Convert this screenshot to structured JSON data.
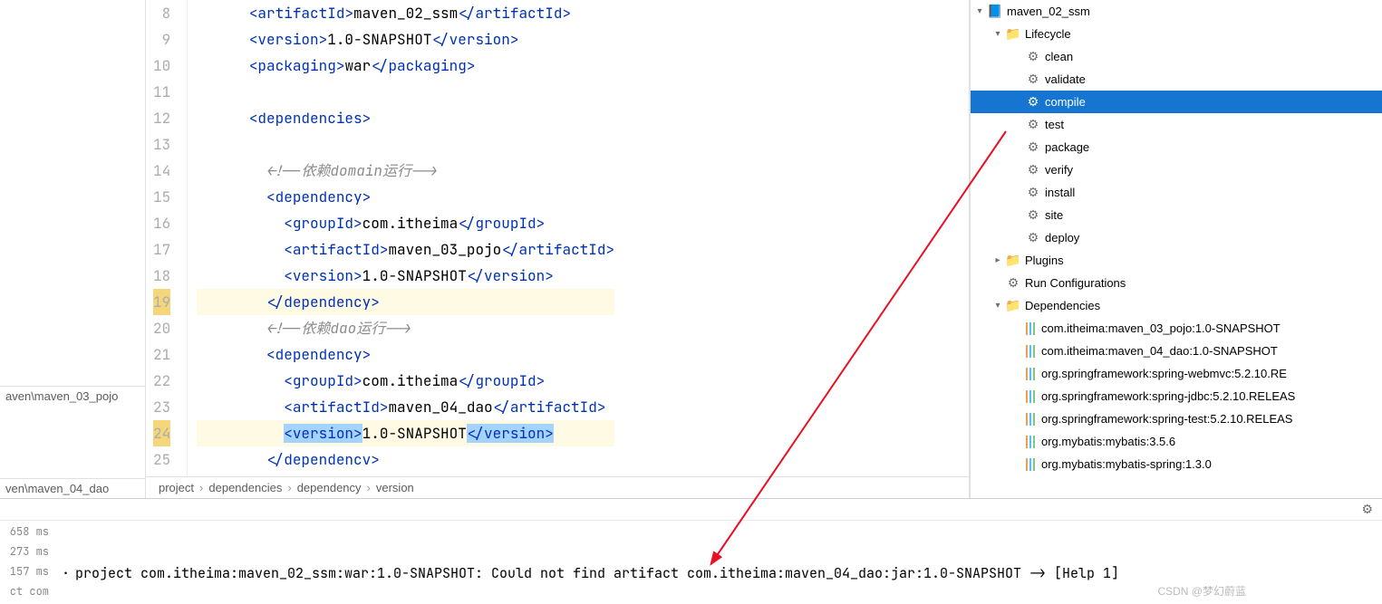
{
  "editor": {
    "lines": [
      {
        "num": 8,
        "indent": 3,
        "type": "el",
        "tag": "artifactId",
        "content": "maven_02_ssm"
      },
      {
        "num": 9,
        "indent": 3,
        "type": "el",
        "tag": "version",
        "content": "1.0-SNAPSHOT"
      },
      {
        "num": 10,
        "indent": 3,
        "type": "el",
        "tag": "packaging",
        "content": "war"
      },
      {
        "num": 11,
        "indent": 0,
        "type": "blank"
      },
      {
        "num": 12,
        "indent": 3,
        "type": "open",
        "tag": "dependencies"
      },
      {
        "num": 13,
        "indent": 0,
        "type": "blank"
      },
      {
        "num": 14,
        "indent": 4,
        "type": "comment",
        "content": "<!--依赖domain运行-->"
      },
      {
        "num": 15,
        "indent": 4,
        "type": "open",
        "tag": "dependency"
      },
      {
        "num": 16,
        "indent": 5,
        "type": "el",
        "tag": "groupId",
        "content": "com.itheima"
      },
      {
        "num": 17,
        "indent": 5,
        "type": "el",
        "tag": "artifactId",
        "content": "maven_03_pojo"
      },
      {
        "num": 18,
        "indent": 5,
        "type": "el",
        "tag": "version",
        "content": "1.0-SNAPSHOT"
      },
      {
        "num": 19,
        "indent": 4,
        "type": "close",
        "tag": "dependency",
        "hl": true
      },
      {
        "num": 20,
        "indent": 4,
        "type": "comment",
        "content": "<!--依赖dao运行-->"
      },
      {
        "num": 21,
        "indent": 4,
        "type": "open",
        "tag": "dependency"
      },
      {
        "num": 22,
        "indent": 5,
        "type": "el",
        "tag": "groupId",
        "content": "com.itheima"
      },
      {
        "num": 23,
        "indent": 5,
        "type": "el",
        "tag": "artifactId",
        "content": "maven_04_dao"
      },
      {
        "num": 24,
        "indent": 5,
        "type": "el",
        "tag": "version",
        "content": "1.0-SNAPSHOT",
        "sel": true,
        "hl": true
      },
      {
        "num": 25,
        "indent": 4,
        "type": "close",
        "tag": "dependencv"
      }
    ],
    "breadcrumb": [
      "project",
      "dependencies",
      "dependency",
      "version"
    ]
  },
  "left_tabs": [
    "aven\\maven_03_pojo",
    "ven\\maven_04_dao"
  ],
  "maven": {
    "root": "maven_02_ssm",
    "lifecycle_label": "Lifecycle",
    "lifecycle": [
      "clean",
      "validate",
      "compile",
      "test",
      "package",
      "verify",
      "install",
      "site",
      "deploy"
    ],
    "selected": "compile",
    "plugins_label": "Plugins",
    "run_config_label": "Run Configurations",
    "deps_label": "Dependencies",
    "deps": [
      "com.itheima:maven_03_pojo:1.0-SNAPSHOT",
      "com.itheima:maven_04_dao:1.0-SNAPSHOT",
      "org.springframework:spring-webmvc:5.2.10.RE",
      "org.springframework:spring-jdbc:5.2.10.RELEAS",
      "org.springframework:spring-test:5.2.10.RELEAS",
      "org.mybatis:mybatis:3.5.6",
      "org.mybatis:mybatis-spring:1.3.0"
    ]
  },
  "console": {
    "timings": [
      "658 ms",
      "273 ms",
      "157 ms",
      "ct com"
    ],
    "error": "project com.itheima:maven_02_ssm:war:1.0-SNAPSHOT: Could not find artifact com.itheima:maven_04_dao:jar:1.0-SNAPSHOT -> [Help 1]"
  },
  "watermark": "CSDN @梦幻蔚蓝"
}
